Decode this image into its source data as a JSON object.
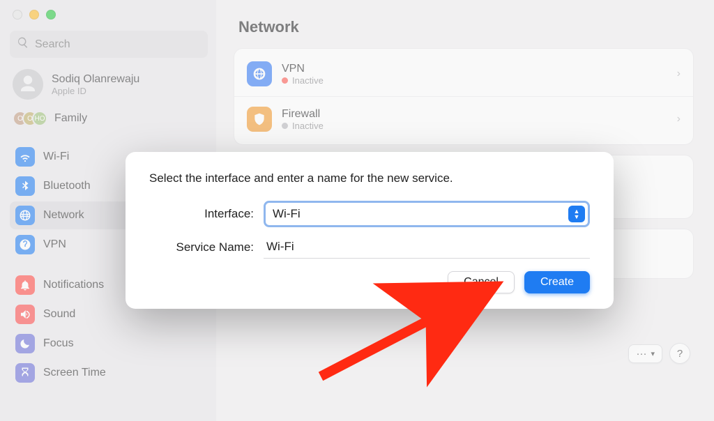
{
  "sidebar": {
    "search_placeholder": "Search",
    "account": {
      "name": "Sodiq Olanrewaju",
      "sub": "Apple ID"
    },
    "family_label": "Family",
    "items": [
      {
        "label": "Wi-Fi"
      },
      {
        "label": "Bluetooth"
      },
      {
        "label": "Network"
      },
      {
        "label": "VPN"
      },
      {
        "label": "Notifications"
      },
      {
        "label": "Sound"
      },
      {
        "label": "Focus"
      },
      {
        "label": "Screen Time"
      }
    ]
  },
  "content": {
    "title": "Network",
    "services": [
      {
        "name": "VPN",
        "status": "Inactive",
        "status_color": "red"
      },
      {
        "name": "Firewall",
        "status": "Inactive",
        "status_color": "gray"
      }
    ],
    "more_label": "···",
    "help_label": "?"
  },
  "modal": {
    "prompt": "Select the interface and enter a name for the new service.",
    "interface_label": "Interface:",
    "interface_value": "Wi-Fi",
    "service_name_label": "Service Name:",
    "service_name_value": "Wi-Fi",
    "cancel_label": "Cancel",
    "create_label": "Create"
  }
}
